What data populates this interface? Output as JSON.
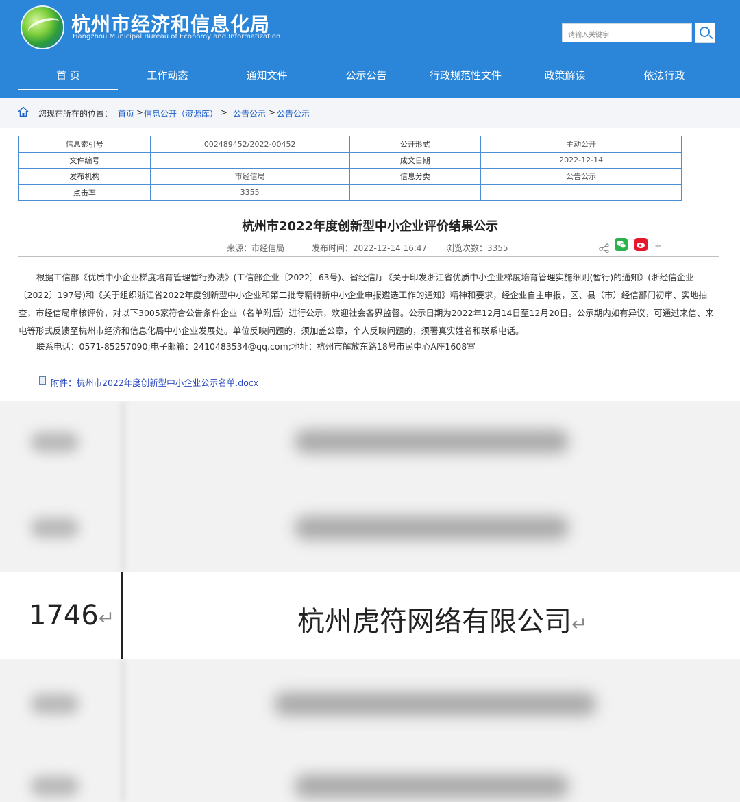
{
  "header": {
    "site_title": "杭州市经济和信息化局",
    "site_subtitle": "Hangzhou Municipal Bureau of Economy and Informatization",
    "search_placeholder": "请输入关键字",
    "brand_color": "#2b86d9"
  },
  "nav": {
    "items": [
      {
        "label": "首 页",
        "active": true
      },
      {
        "label": "工作动态"
      },
      {
        "label": "通知文件"
      },
      {
        "label": "公示公告"
      },
      {
        "label": "行政规范性文件"
      },
      {
        "label": "政策解读"
      },
      {
        "label": "依法行政"
      }
    ]
  },
  "breadcrumb": {
    "prefix": "您现在所在的位置：",
    "items": [
      "首页",
      "信息公开（资源库）",
      "公告公示",
      "公告公示"
    ],
    "separators": [
      ">",
      " > ",
      ">"
    ]
  },
  "info_table": [
    [
      "信息索引号",
      "002489452/2022-00452",
      "公开形式",
      "主动公开"
    ],
    [
      "文件编号",
      "",
      "成文日期",
      "2022-12-14"
    ],
    [
      "发布机构",
      "市经信局",
      "信息分类",
      "公告公示"
    ],
    [
      "点击率",
      "3355",
      "",
      ""
    ]
  ],
  "article": {
    "title": "杭州市2022年度创新型中小企业评价结果公示",
    "source": "来源：市经信局",
    "published": "发布时间：2022-12-14 16:47",
    "views": "浏览次数：3355",
    "body": "根据工信部《优质中小企业梯度培育管理暂行办法》(工信部企业〔2022〕63号)、省经信厅《关于印发浙江省优质中小企业梯度培育管理实施细则(暂行)的通知》(浙经信企业〔2022〕197号)和《关于组织浙江省2022年度创新型中小企业和第二批专精特新中小企业申报遴选工作的通知》精神和要求，经企业自主申报，区、县（市）经信部门初审、实地抽查，市经信局审核评价，对以下3005家符合公告条件企业（名单附后）进行公示，欢迎社会各界监督。公示日期为2022年12月14日至12月20日。公示期内如有异议，可通过来信、来电等形式反馈至杭州市经济和信息化局中小企业发展处。单位反映问题的，须加盖公章，个人反映问题的，须署真实姓名和联系电话。",
    "contact": "联系电话：0571-85257090;电子邮箱：2410483534@qq.com;地址：杭州市解放东路18号市民中心A座1608室",
    "attachment": "附件：杭州市2022年度创新型中小企业公示名单.docx"
  },
  "document_view": {
    "highlight_number": "1746",
    "highlight_company": "杭州虎符网络有限公司",
    "return_mark": "↵"
  }
}
